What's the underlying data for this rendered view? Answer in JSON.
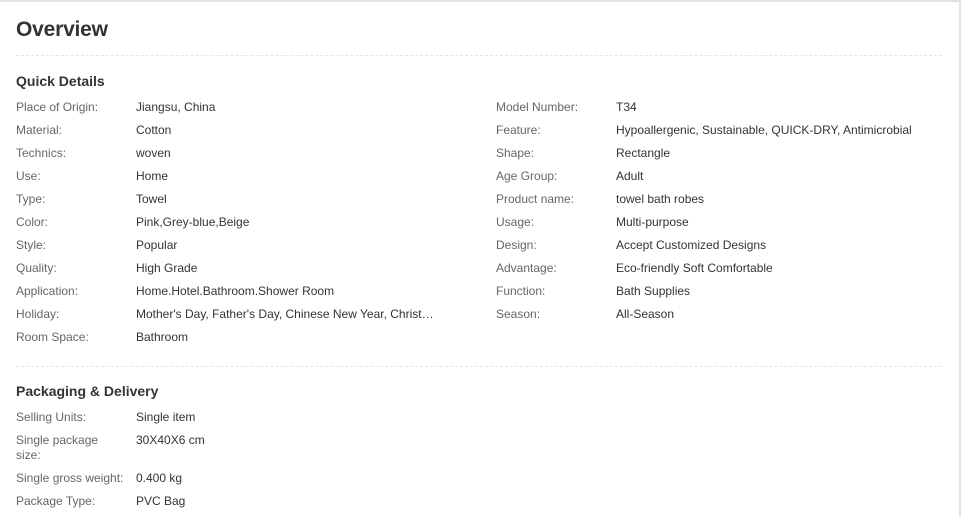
{
  "page": {
    "title": "Overview"
  },
  "quick_details": {
    "heading": "Quick Details",
    "left": [
      {
        "label": "Place of Origin:",
        "value": "Jiangsu, China"
      },
      {
        "label": "Material:",
        "value": "Cotton"
      },
      {
        "label": "Technics:",
        "value": "woven"
      },
      {
        "label": "Use:",
        "value": "Home"
      },
      {
        "label": "Type:",
        "value": "Towel"
      },
      {
        "label": "Color:",
        "value": "Pink,Grey-blue,Beige"
      },
      {
        "label": "Style:",
        "value": "Popular"
      },
      {
        "label": "Quality:",
        "value": "High Grade"
      },
      {
        "label": "Application:",
        "value": "Home.Hotel.Bathroom.Shower Room"
      },
      {
        "label": "Holiday:",
        "value": "Mother's Day, Father's Day, Chinese New Year, Christm..."
      },
      {
        "label": "Room Space:",
        "value": "Bathroom"
      }
    ],
    "right": [
      {
        "label": "Model Number:",
        "value": "T34"
      },
      {
        "label": "Feature:",
        "value": "Hypoallergenic, Sustainable, QUICK-DRY, Antimicrobial"
      },
      {
        "label": "Shape:",
        "value": "Rectangle"
      },
      {
        "label": "Age Group:",
        "value": "Adult"
      },
      {
        "label": "Product name:",
        "value": "towel bath robes"
      },
      {
        "label": "Usage:",
        "value": "Multi-purpose"
      },
      {
        "label": "Design:",
        "value": "Accept Customized Designs"
      },
      {
        "label": "Advantage:",
        "value": "Eco-friendly Soft Comfortable"
      },
      {
        "label": "Function:",
        "value": "Bath Supplies"
      },
      {
        "label": "Season:",
        "value": "All-Season"
      }
    ]
  },
  "packaging": {
    "heading": "Packaging & Delivery",
    "rows": [
      {
        "label": "Selling Units:",
        "value": "Single item"
      },
      {
        "label": "Single package size:",
        "value": "30X40X6 cm"
      },
      {
        "label": "Single gross weight:",
        "value": "0.400 kg"
      },
      {
        "label": "Package Type:",
        "value": "PVC Bag"
      }
    ]
  }
}
